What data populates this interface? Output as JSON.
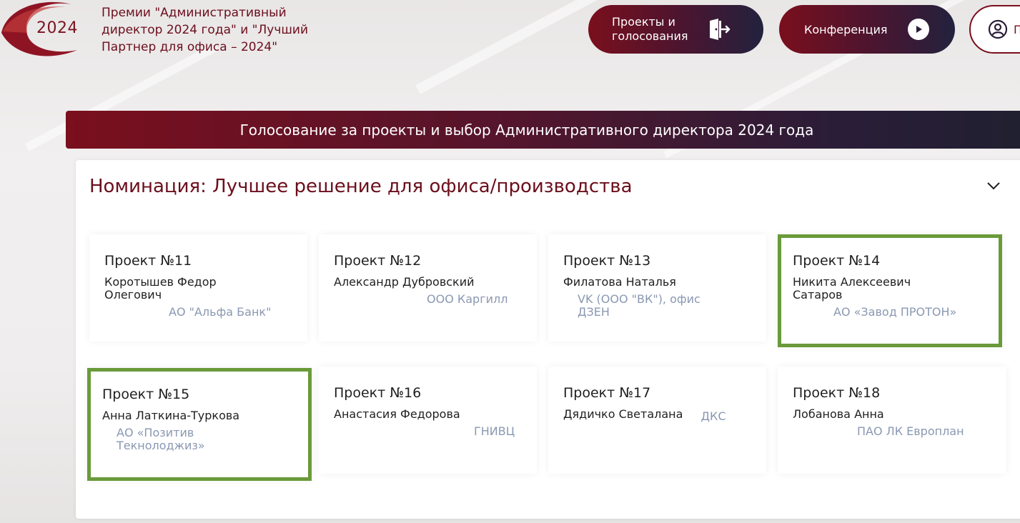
{
  "header": {
    "logo_year": "2024",
    "title": "Премии \"Административный директор 2024 года\" и \"Лучший Партнер для офиса – 2024\""
  },
  "nav": {
    "projects_label": "Проекты и голосования",
    "conference_label": "Конференция",
    "profile_label": "П"
  },
  "banner": {
    "text": "Голосование за проекты и выбор Административного директора 2024 года"
  },
  "nomination": {
    "title": "Номинация: Лучшее решение для офиса/производства"
  },
  "projects": [
    {
      "number": "Проект №11",
      "person": "Коротышев Федор Олегович",
      "org": "АО \"Альфа Банк\""
    },
    {
      "number": "Проект №12",
      "person": "Александр Дубровский",
      "org": "ООО Каргилл"
    },
    {
      "number": "Проект №13",
      "person": "Филатова Наталья",
      "org": "VK (ООО \"ВК\"), офис ДЗЕН"
    },
    {
      "number": "Проект №14",
      "person": "Никита Алексеевич Сатаров",
      "org": "АО «Завод ПРОТОН»"
    },
    {
      "number": "Проект №15",
      "person": "Анна Латкина-Туркова",
      "org": "АО «Позитив Текнолоджиз»"
    },
    {
      "number": "Проект №16",
      "person": "Анастасия Федорова",
      "org": "ГНИВЦ"
    },
    {
      "number": "Проект №17",
      "person": "Дядичко Светалана",
      "org": "ДКС"
    },
    {
      "number": "Проект №18",
      "person": "Лобанова Анна",
      "org": "ПАО ЛК Европлан"
    }
  ],
  "colors": {
    "brand": "#7a0f1d",
    "highlight": "#6a9a3a",
    "org_text": "#8a98b2"
  }
}
